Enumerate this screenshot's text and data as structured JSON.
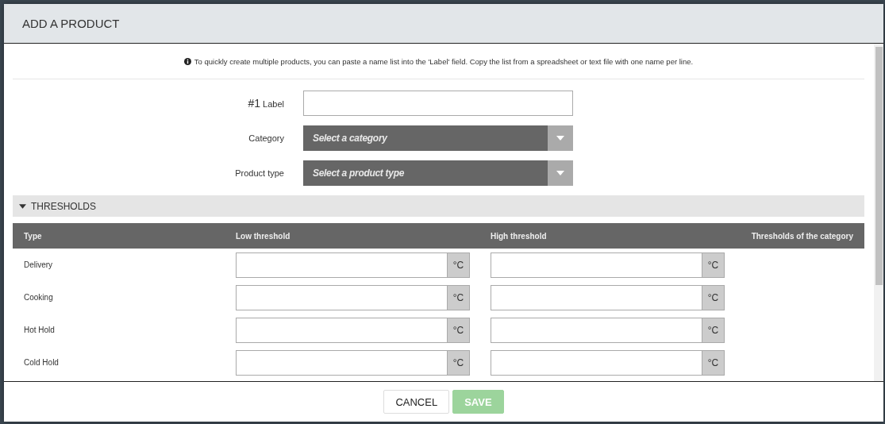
{
  "dialog": {
    "title": "ADD A PRODUCT",
    "info": "To quickly create multiple products, you can paste a name list into the 'Label' field. Copy the list from a spreadsheet or text file with one name per line.",
    "form": {
      "label_number": "#1",
      "label": "Label",
      "selects": [
        {
          "label": "Category",
          "placeholder": "Select a category"
        },
        {
          "label": "Product type",
          "placeholder": "Select a product type"
        }
      ]
    },
    "thresholds": {
      "title": "THRESHOLDS",
      "expanded": true,
      "columns": [
        "Type",
        "Low threshold",
        "High threshold",
        "Thresholds of the category"
      ],
      "rows": [
        {
          "type": "Delivery",
          "low_unit": "°C",
          "high_unit": "°C"
        },
        {
          "type": "Cooking",
          "low_unit": "°C",
          "high_unit": "°C"
        },
        {
          "type": "Hot Hold",
          "low_unit": "°C",
          "high_unit": "°C"
        },
        {
          "type": "Cold Hold",
          "low_unit": "°C",
          "high_unit": "°C"
        }
      ]
    },
    "buttons": [
      {
        "label": "CANCEL",
        "kind": "secondary",
        "disabled": false
      },
      {
        "label": "SAVE",
        "kind": "primary",
        "disabled": true
      }
    ]
  }
}
